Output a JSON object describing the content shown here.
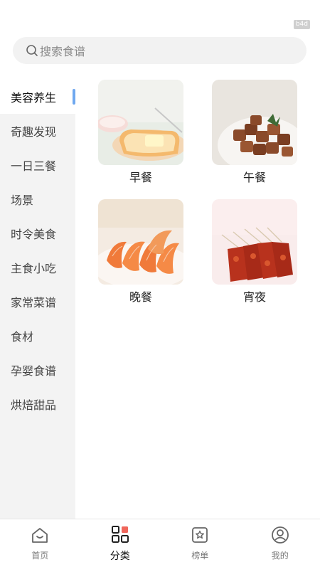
{
  "status": {
    "badge": "b4d"
  },
  "search": {
    "placeholder": "搜索食谱"
  },
  "sidebar": {
    "items": [
      {
        "label": "美容养生",
        "active": true
      },
      {
        "label": "奇趣发现"
      },
      {
        "label": "一日三餐"
      },
      {
        "label": "场景"
      },
      {
        "label": "时令美食"
      },
      {
        "label": "主食小吃"
      },
      {
        "label": "家常菜谱"
      },
      {
        "label": "食材"
      },
      {
        "label": "孕婴食谱"
      },
      {
        "label": "烘焙甜品"
      }
    ]
  },
  "categories": [
    {
      "label": "早餐",
      "image": "toast-image"
    },
    {
      "label": "午餐",
      "image": "beef-cubes-image"
    },
    {
      "label": "晚餐",
      "image": "shrimp-image"
    },
    {
      "label": "宵夜",
      "image": "skewers-image"
    }
  ],
  "tabbar": {
    "items": [
      {
        "label": "首页",
        "icon": "home-icon"
      },
      {
        "label": "分类",
        "icon": "category-icon",
        "active": true
      },
      {
        "label": "榜单",
        "icon": "ranking-icon"
      },
      {
        "label": "我的",
        "icon": "profile-icon"
      }
    ]
  },
  "colors": {
    "accent": "#6fa8ef",
    "active_tab_accent": "#f0665b",
    "sidebar_bg": "#f3f3f3"
  }
}
